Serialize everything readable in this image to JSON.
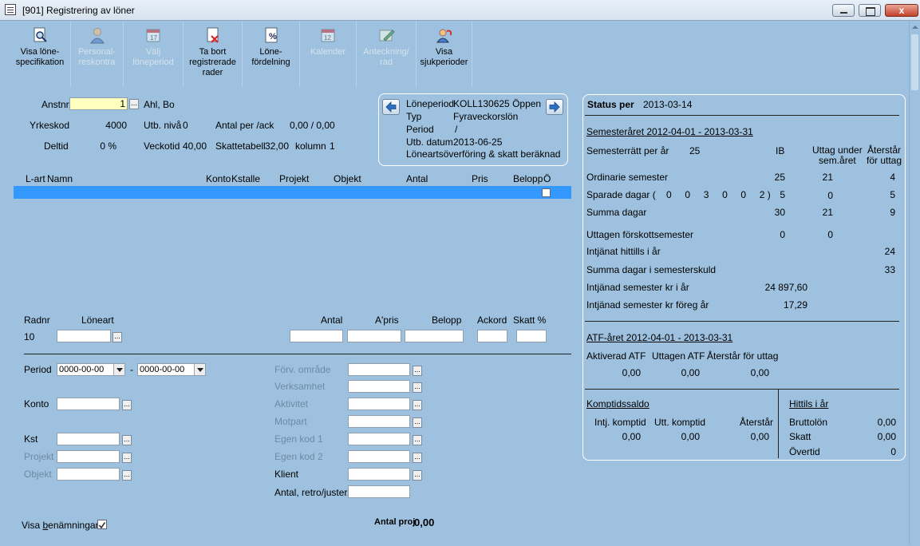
{
  "window": {
    "title": "[901]  Registrering av löner",
    "close": "x"
  },
  "toolbar": [
    {
      "label": "Visa löne-\nspecifikation",
      "icon": "magnifier-doc-icon",
      "enabled": true
    },
    {
      "label": "Personal-\nreskontra",
      "icon": "person-icon",
      "enabled": false
    },
    {
      "label": "Välj\nlöneperiod",
      "icon": "calendar-icon",
      "enabled": false
    },
    {
      "label": "Ta bort\nregistrerade\nrader",
      "icon": "delete-doc-icon",
      "enabled": true
    },
    {
      "label": "Löne-\nfördelning",
      "icon": "percent-doc-icon",
      "enabled": true
    },
    {
      "label": "Kalender",
      "icon": "calendar-12-icon",
      "enabled": false
    },
    {
      "label": "Anteckning/\nrad",
      "icon": "note-pencil-icon",
      "enabled": false
    },
    {
      "label": "Visa\nsjukperioder",
      "icon": "sick-person-icon",
      "enabled": true
    }
  ],
  "emp": {
    "anstnr_label": "Anstnr",
    "anstnr": "1",
    "name": "Ahl, Bo",
    "yrkeskod_label": "Yrkeskod",
    "yrkeskod": "4000",
    "utbniva_label": "Utb. nivå",
    "utbniva": "0",
    "antal_label": "Antal per /ack",
    "antal": "0,00 /  0,00",
    "deltid_label": "Deltid",
    "deltid": "0 %",
    "veckotid_label": "Veckotid",
    "veckotid": "40,00",
    "skattetabell_label": "Skattetabell",
    "skattetabell": "32,00",
    "kolumn_label": "kolumn",
    "kolumn": "1"
  },
  "period": {
    "l1": "Löneperiod",
    "v1": "KOLL130625 Öppen",
    "l2": "Typ",
    "v2": "Fyraveckorslön",
    "l3": "Period",
    "v3": "/",
    "l4": "Utb. datum",
    "v4": "2013-06-25",
    "note": "Löneartsöverföring & skatt beräknad"
  },
  "grid": {
    "cols": [
      "L-art",
      "Namn",
      "Konto",
      "Kstalle",
      "Projekt",
      "Objekt",
      "Antal",
      "Pris",
      "Belopp",
      "Ö"
    ]
  },
  "row": {
    "radnr_label": "Radnr",
    "radnr": "10",
    "loneart_label": "Löneart",
    "antal": "Antal",
    "apris": "A'pris",
    "belopp": "Belopp",
    "ackord": "Ackord",
    "skatt": "Skatt %"
  },
  "form": {
    "period": "Period",
    "date_from": "0000-00-00",
    "sep": "-",
    "date_to": "0000-00-00",
    "konto": "Konto",
    "kst": "Kst",
    "projekt": "Projekt",
    "objekt": "Objekt",
    "forv": "Förv. område",
    "verksamhet": "Verksamhet",
    "aktivitet": "Aktivitet",
    "motpart": "Motpart",
    "egen1": "Egen kod 1",
    "egen2": "Egen kod 2",
    "klient": "Klient",
    "antal_retro": "Antal, retro/juster.",
    "visa_ben": "Visa benämningar",
    "visa_ben_underline": "b",
    "antal_proj_label": "Antal proj",
    "antal_proj": "0,00"
  },
  "status": {
    "title": "Status per",
    "date": "2013-03-14",
    "sem_title": "Semesteråret 2012-04-01 - 2013-03-31",
    "ratt": "Semesterrätt per år",
    "ratt_val": "25",
    "ib": "IB",
    "uttag": "Uttag under\nsem.året",
    "aterstar": "Återstår\nför uttag",
    "ord": "Ordinarie semester",
    "ord_ib": "25",
    "ord_ut": "21",
    "ord_at": "4",
    "spar": "Sparade dagar (    0     0     3     0     0     2 )",
    "spar_ib": "5",
    "spar_ut": "0",
    "spar_at": "5",
    "summa": "Summa dagar",
    "summa_ib": "30",
    "summa_ut": "21",
    "summa_at": "9",
    "forskott": "Uttagen förskottsemester",
    "forskott_ib": "0",
    "forskott_ut": "0",
    "intjanat": "Intjänat hittills i år",
    "intjanat_v": "24",
    "skuld": "Summa dagar i semesterskuld",
    "skuld_v": "33",
    "kr": "Intjänad semester kr i år",
    "kr_v": "24 897,60",
    "kr_foreg": "Intjänad semester kr föreg år",
    "kr_foreg_v": "17,29",
    "atf_title": "ATF-året 2012-04-01 - 2013-03-31",
    "atf_akt": "Aktiverad ATF",
    "atf_utt": "Uttagen ATF",
    "atf_at": "Återstår för uttag",
    "atf_v1": "0,00",
    "atf_v2": "0,00",
    "atf_v3": "0,00",
    "komp_title": "Komptidssaldo",
    "komp_i": "Intj. komptid",
    "komp_u": "Utt. komptid",
    "komp_a": "Återstår",
    "komp_v1": "0,00",
    "komp_v2": "0,00",
    "komp_v3": "0,00",
    "hittils": "Hittils i år",
    "brutto": "Bruttolön",
    "brutto_v": "0,00",
    "skatt": "Skatt",
    "skatt_v": "0,00",
    "overtid": "Övertid",
    "overtid_v": "0"
  }
}
